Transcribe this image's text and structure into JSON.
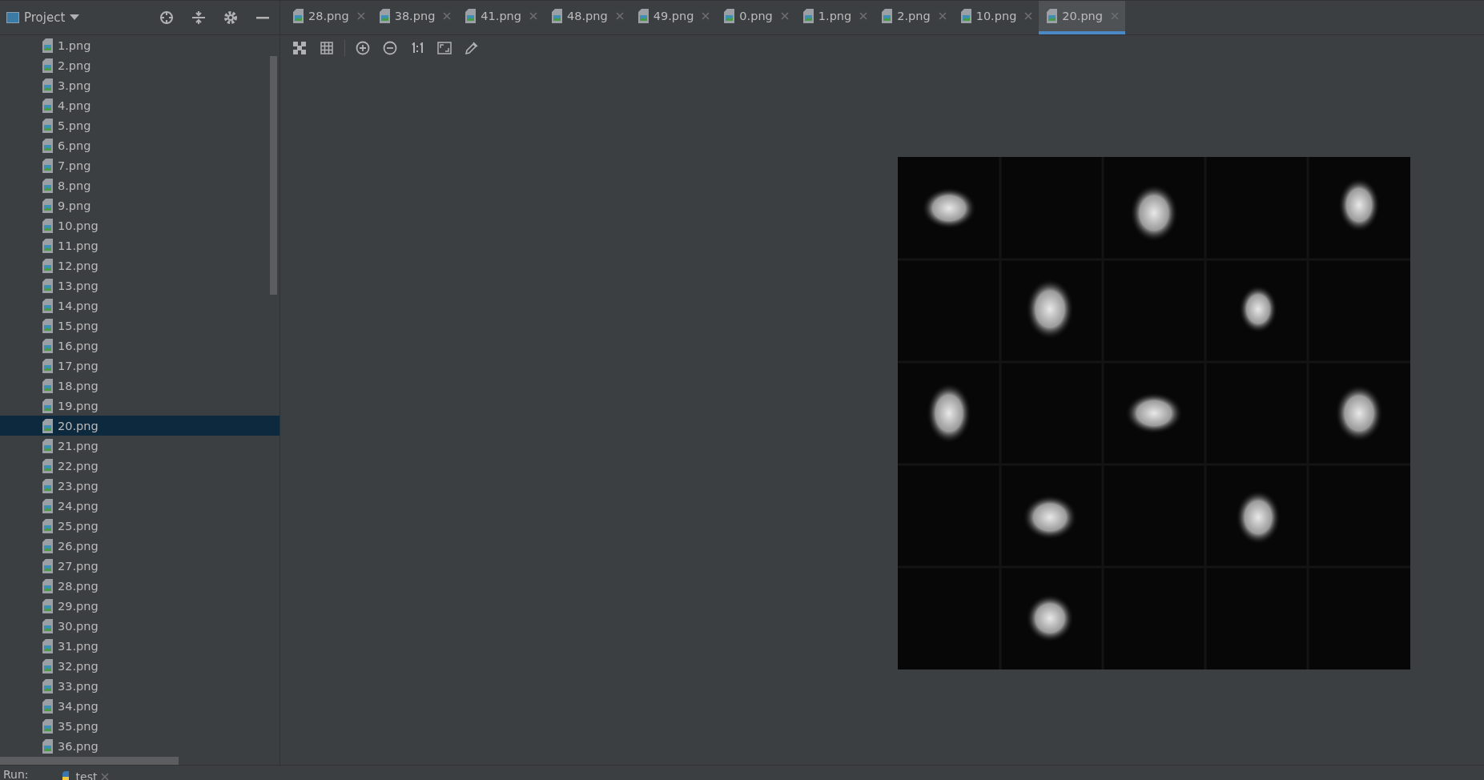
{
  "sidebar": {
    "title": "Project",
    "items": [
      {
        "label": "1.png",
        "selected": false
      },
      {
        "label": "2.png",
        "selected": false
      },
      {
        "label": "3.png",
        "selected": false
      },
      {
        "label": "4.png",
        "selected": false
      },
      {
        "label": "5.png",
        "selected": false
      },
      {
        "label": "6.png",
        "selected": false
      },
      {
        "label": "7.png",
        "selected": false
      },
      {
        "label": "8.png",
        "selected": false
      },
      {
        "label": "9.png",
        "selected": false
      },
      {
        "label": "10.png",
        "selected": false
      },
      {
        "label": "11.png",
        "selected": false
      },
      {
        "label": "12.png",
        "selected": false
      },
      {
        "label": "13.png",
        "selected": false
      },
      {
        "label": "14.png",
        "selected": false
      },
      {
        "label": "15.png",
        "selected": false
      },
      {
        "label": "16.png",
        "selected": false
      },
      {
        "label": "17.png",
        "selected": false
      },
      {
        "label": "18.png",
        "selected": false
      },
      {
        "label": "19.png",
        "selected": false
      },
      {
        "label": "20.png",
        "selected": true
      },
      {
        "label": "21.png",
        "selected": false
      },
      {
        "label": "22.png",
        "selected": false
      },
      {
        "label": "23.png",
        "selected": false
      },
      {
        "label": "24.png",
        "selected": false
      },
      {
        "label": "25.png",
        "selected": false
      },
      {
        "label": "26.png",
        "selected": false
      },
      {
        "label": "27.png",
        "selected": false
      },
      {
        "label": "28.png",
        "selected": false
      },
      {
        "label": "29.png",
        "selected": false
      },
      {
        "label": "30.png",
        "selected": false
      },
      {
        "label": "31.png",
        "selected": false
      },
      {
        "label": "32.png",
        "selected": false
      },
      {
        "label": "33.png",
        "selected": false
      },
      {
        "label": "34.png",
        "selected": false
      },
      {
        "label": "35.png",
        "selected": false
      },
      {
        "label": "36.png",
        "selected": false
      }
    ]
  },
  "tabs": [
    {
      "label": "28.png",
      "selected": false
    },
    {
      "label": "38.png",
      "selected": false
    },
    {
      "label": "41.png",
      "selected": false
    },
    {
      "label": "48.png",
      "selected": false
    },
    {
      "label": "49.png",
      "selected": false
    },
    {
      "label": "0.png",
      "selected": false
    },
    {
      "label": "1.png",
      "selected": false
    },
    {
      "label": "2.png",
      "selected": false
    },
    {
      "label": "10.png",
      "selected": false
    },
    {
      "label": "20.png",
      "selected": true
    }
  ],
  "run_bar": {
    "label": "Run:",
    "config": "test"
  }
}
